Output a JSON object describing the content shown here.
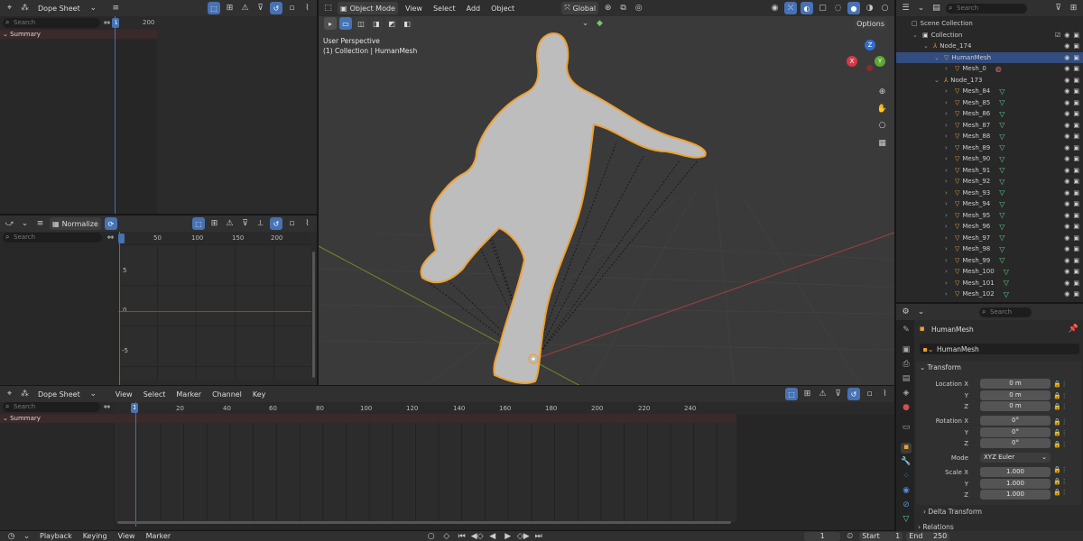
{
  "dopesheet_top": {
    "editor": "Dope Sheet",
    "search_placeholder": "Search",
    "summary": "Summary",
    "frame": "1",
    "tick_200": "200"
  },
  "graph": {
    "normalize": "Normalize",
    "search_placeholder": "Search",
    "ticks_x": [
      "1",
      "50",
      "100",
      "150",
      "200"
    ],
    "ticks_y": [
      "5",
      "0",
      "-5"
    ]
  },
  "viewport": {
    "mode": "Object Mode",
    "menus": [
      "View",
      "Select",
      "Add",
      "Object"
    ],
    "orientation": "Global",
    "perspective": "User Perspective",
    "collection_info": "(1) Collection | HumanMesh",
    "options": "Options",
    "axes": {
      "x": "X",
      "y": "Y",
      "z": "Z"
    }
  },
  "dopesheet_bottom": {
    "editor": "Dope Sheet",
    "menus": [
      "View",
      "Select",
      "Marker",
      "Channel",
      "Key"
    ],
    "search_placeholder": "Search",
    "summary": "Summary",
    "frame": "1",
    "ticks": [
      "20",
      "40",
      "60",
      "80",
      "100",
      "120",
      "140",
      "160",
      "180",
      "200",
      "220",
      "240"
    ]
  },
  "timeline": {
    "menus": [
      "Playback",
      "Keying",
      "View",
      "Marker"
    ],
    "current": "1",
    "start_label": "Start",
    "start": "1",
    "end_label": "End",
    "end": "250"
  },
  "outliner": {
    "search_placeholder": "Search",
    "rows": [
      {
        "label": "Scene Collection",
        "indent": 0
      },
      {
        "label": "Collection",
        "indent": 1
      },
      {
        "label": "Node_174",
        "indent": 2
      },
      {
        "label": "HumanMesh",
        "indent": 3
      },
      {
        "label": "Mesh_0",
        "indent": 4
      },
      {
        "label": "Node_173",
        "indent": 3
      },
      {
        "label": "Mesh_84",
        "indent": 4
      },
      {
        "label": "Mesh_85",
        "indent": 4
      },
      {
        "label": "Mesh_86",
        "indent": 4
      },
      {
        "label": "Mesh_87",
        "indent": 4
      },
      {
        "label": "Mesh_88",
        "indent": 4
      },
      {
        "label": "Mesh_89",
        "indent": 4
      },
      {
        "label": "Mesh_90",
        "indent": 4
      },
      {
        "label": "Mesh_91",
        "indent": 4
      },
      {
        "label": "Mesh_92",
        "indent": 4
      },
      {
        "label": "Mesh_93",
        "indent": 4
      },
      {
        "label": "Mesh_94",
        "indent": 4
      },
      {
        "label": "Mesh_95",
        "indent": 4
      },
      {
        "label": "Mesh_96",
        "indent": 4
      },
      {
        "label": "Mesh_97",
        "indent": 4
      },
      {
        "label": "Mesh_98",
        "indent": 4
      },
      {
        "label": "Mesh_99",
        "indent": 4
      },
      {
        "label": "Mesh_100",
        "indent": 4
      },
      {
        "label": "Mesh_101",
        "indent": 4
      },
      {
        "label": "Mesh_102",
        "indent": 4
      }
    ]
  },
  "properties": {
    "search_placeholder": "Search",
    "object_name": "HumanMesh",
    "data_name": "HumanMesh",
    "transform": "Transform",
    "location_label": "Location X",
    "loc": [
      "0 m",
      "0 m",
      "0 m"
    ],
    "rotation_label": "Rotation X",
    "rot": [
      "0°",
      "0°",
      "0°"
    ],
    "mode_label": "Mode",
    "mode": "XYZ Euler",
    "scale_label": "Scale X",
    "scale": [
      "1.000",
      "1.000",
      "1.000"
    ],
    "axis_y": "Y",
    "axis_z": "Z",
    "delta": "Delta Transform",
    "relations": "Relations"
  },
  "colors": {
    "accent": "#4772b3",
    "selection": "#e8a040"
  }
}
